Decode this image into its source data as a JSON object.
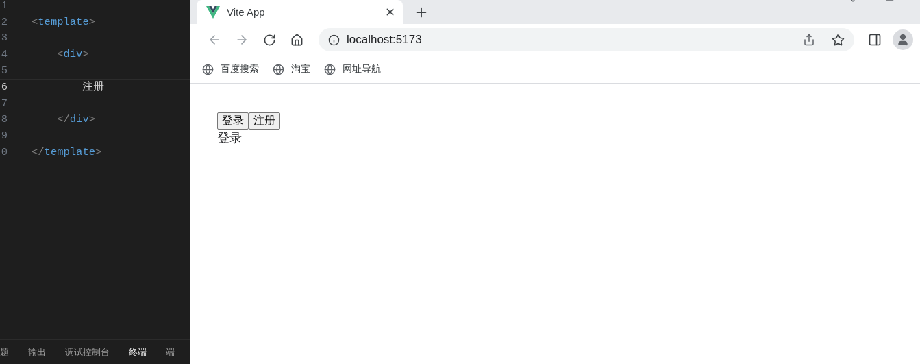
{
  "editor": {
    "lines": [
      {
        "number": "1",
        "current": false
      },
      {
        "number": "2",
        "current": false,
        "tokens": [
          {
            "kind": "punct",
            "text": "<"
          },
          {
            "kind": "tag",
            "text": "template"
          },
          {
            "kind": "punct",
            "text": ">"
          }
        ]
      },
      {
        "number": "3",
        "current": false
      },
      {
        "number": "4",
        "current": false,
        "tokens": [
          {
            "kind": "punct",
            "text": "    <"
          },
          {
            "kind": "tag",
            "text": "div"
          },
          {
            "kind": "punct",
            "text": ">"
          }
        ]
      },
      {
        "number": "5",
        "current": false
      },
      {
        "number": "6",
        "current": true,
        "tokens": [
          {
            "kind": "text",
            "text": "        注册"
          }
        ]
      },
      {
        "number": "7",
        "current": false
      },
      {
        "number": "8",
        "current": false,
        "tokens": [
          {
            "kind": "punct",
            "text": "    </"
          },
          {
            "kind": "tag",
            "text": "div"
          },
          {
            "kind": "punct",
            "text": ">"
          }
        ]
      },
      {
        "number": "9",
        "current": false
      },
      {
        "number": "0",
        "current": false,
        "tokens": [
          {
            "kind": "punct",
            "text": "</"
          },
          {
            "kind": "tag",
            "text": "template"
          },
          {
            "kind": "punct",
            "text": ">"
          }
        ]
      }
    ],
    "panel_tabs": [
      {
        "label": "题",
        "selected": false
      },
      {
        "label": "输出",
        "selected": false
      },
      {
        "label": "调试控制台",
        "selected": false
      },
      {
        "label": "终端",
        "selected": true
      },
      {
        "label": "端",
        "selected": false
      }
    ]
  },
  "browser": {
    "tab": {
      "title": "Vite App"
    },
    "address": "localhost:5173",
    "bookmarks": [
      "百度搜索",
      "淘宝",
      "网址导航"
    ],
    "page": {
      "buttons": [
        "登录",
        "注册"
      ],
      "output": "登录"
    }
  }
}
